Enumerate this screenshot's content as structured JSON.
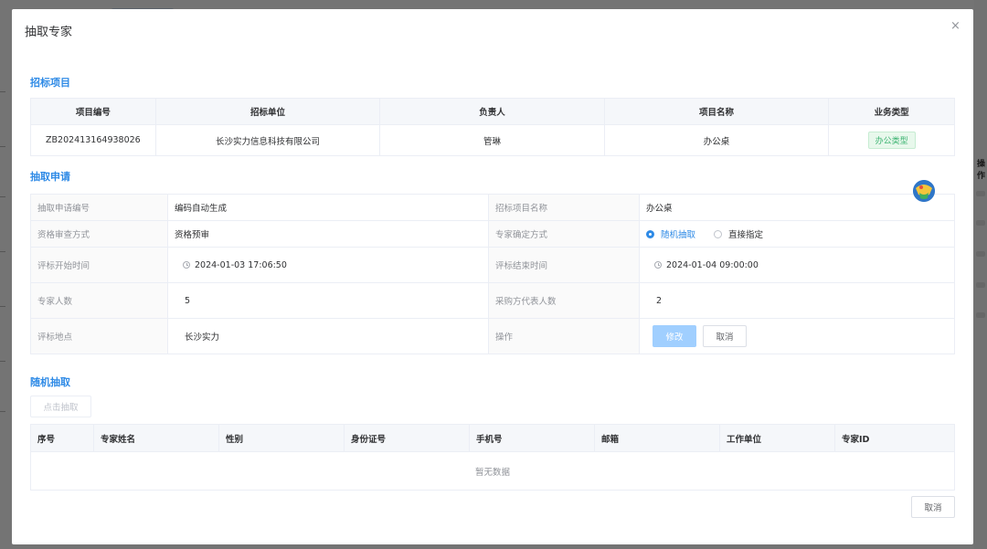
{
  "dialog": {
    "title": "抽取专家",
    "close_icon": "×"
  },
  "section1": {
    "title": "招标项目",
    "headers": [
      "项目编号",
      "招标单位",
      "负责人",
      "项目名称",
      "业务类型"
    ],
    "row": {
      "code": "ZB202413164938026",
      "unit": "长沙实力信息科技有限公司",
      "owner": "管琳",
      "name": "办公桌",
      "type": "办公类型"
    }
  },
  "section2": {
    "title": "抽取申请",
    "rows": [
      {
        "l1": "抽取申请编号",
        "v1": "编码自动生成",
        "l2": "招标项目名称",
        "v2": "办公桌"
      },
      {
        "l1": "资格审查方式",
        "v1": "资格预审",
        "l2": "专家确定方式"
      },
      {
        "l1": "评标开始时间",
        "v1": "2024-01-03 17:06:50",
        "l2": "评标结束时间",
        "v2": "2024-01-04 09:00:00"
      },
      {
        "l1": "专家人数",
        "v1": "5",
        "l2": "采购方代表人数",
        "v2": "2"
      },
      {
        "l1": "评标地点",
        "v1": "长沙实力",
        "l2": "操作"
      }
    ],
    "radio_options": {
      "random": "随机抽取",
      "direct": "直接指定",
      "selected": "random"
    },
    "modify_label": "修改",
    "cancel_label": "取消"
  },
  "section3": {
    "title": "随机抽取",
    "draw_button": "点击抽取",
    "headers": [
      "序号",
      "专家姓名",
      "性别",
      "身份证号",
      "手机号",
      "邮箱",
      "工作单位",
      "专家ID"
    ],
    "empty_text": "暂无数据"
  },
  "footer": {
    "cancel_label": "取消"
  },
  "background": {
    "column_header": "操作"
  }
}
